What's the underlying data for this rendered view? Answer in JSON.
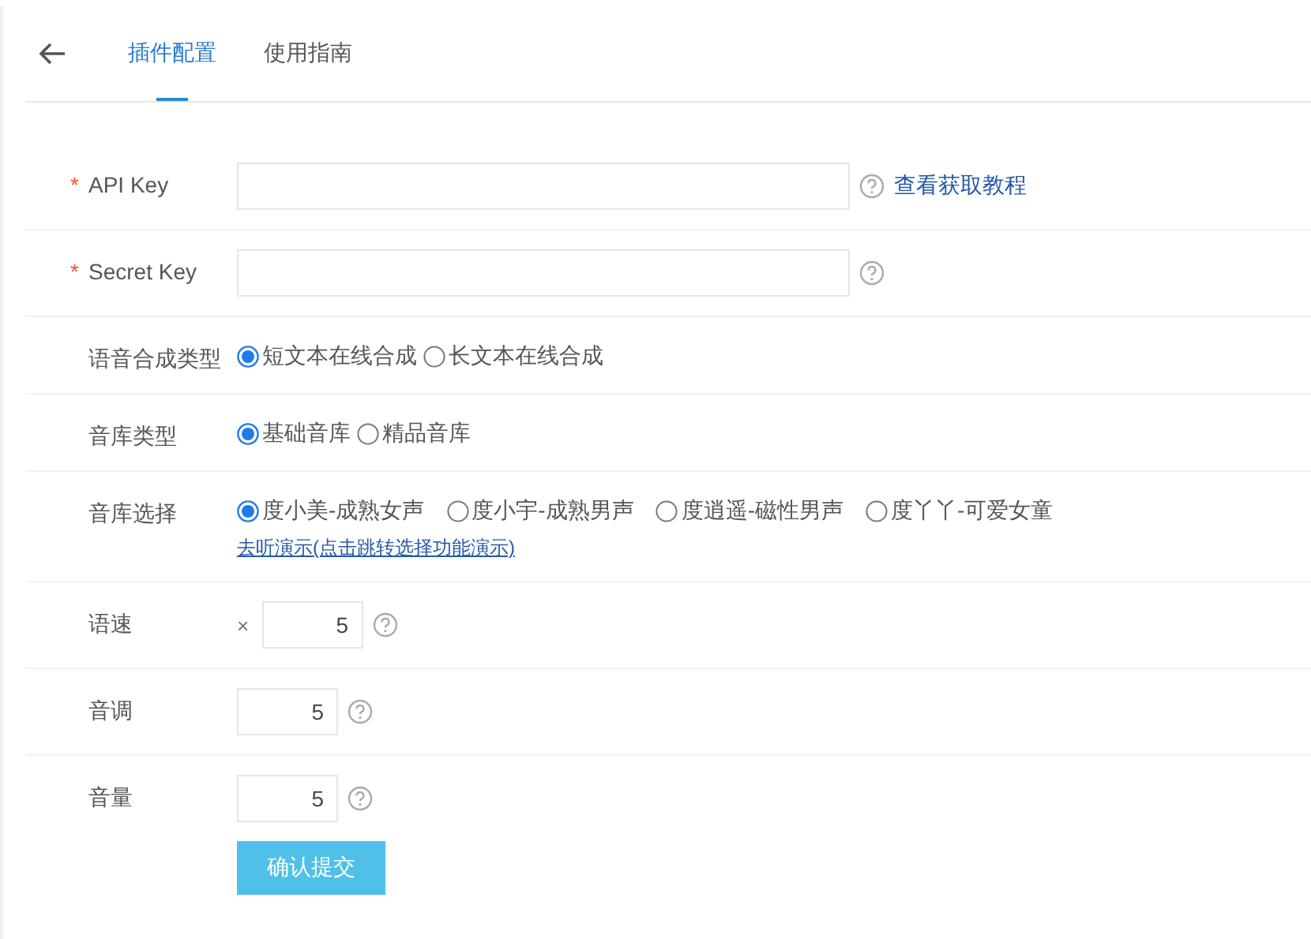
{
  "tabs": [
    {
      "label": "插件配置",
      "selected": true
    },
    {
      "label": "使用指南",
      "selected": false
    }
  ],
  "form": {
    "rows": [
      {
        "kind": "text",
        "label": "API Key",
        "required_mark": "*",
        "value": "",
        "link": "查看获取教程"
      },
      {
        "kind": "text",
        "label": "Secret Key",
        "required_mark": "*",
        "value": ""
      },
      {
        "kind": "radio",
        "label": "语音合成类型",
        "options": [
          {
            "label": "短文本在线合成",
            "selected": true
          },
          {
            "label": "长文本在线合成",
            "selected": false
          }
        ]
      },
      {
        "kind": "radio",
        "label": "音库类型",
        "options": [
          {
            "label": "基础音库",
            "selected": true
          },
          {
            "label": "精品音库",
            "selected": false
          }
        ]
      },
      {
        "kind": "radio",
        "label": "音库选择",
        "options": [
          {
            "label": "度小美-成熟女声",
            "selected": true
          },
          {
            "label": "度小宇-成熟男声",
            "selected": false
          },
          {
            "label": "度逍遥-磁性男声",
            "selected": false
          },
          {
            "label": "度丫丫-可爱女童",
            "selected": false
          }
        ],
        "link": "去听演示(点击跳转选择功能演示)"
      },
      {
        "kind": "number",
        "label": "语速",
        "prefix": "×",
        "value": "5"
      },
      {
        "kind": "number",
        "label": "音调",
        "value": "5"
      },
      {
        "kind": "number",
        "label": "音量",
        "value": "5"
      }
    ],
    "submit": "确认提交"
  }
}
